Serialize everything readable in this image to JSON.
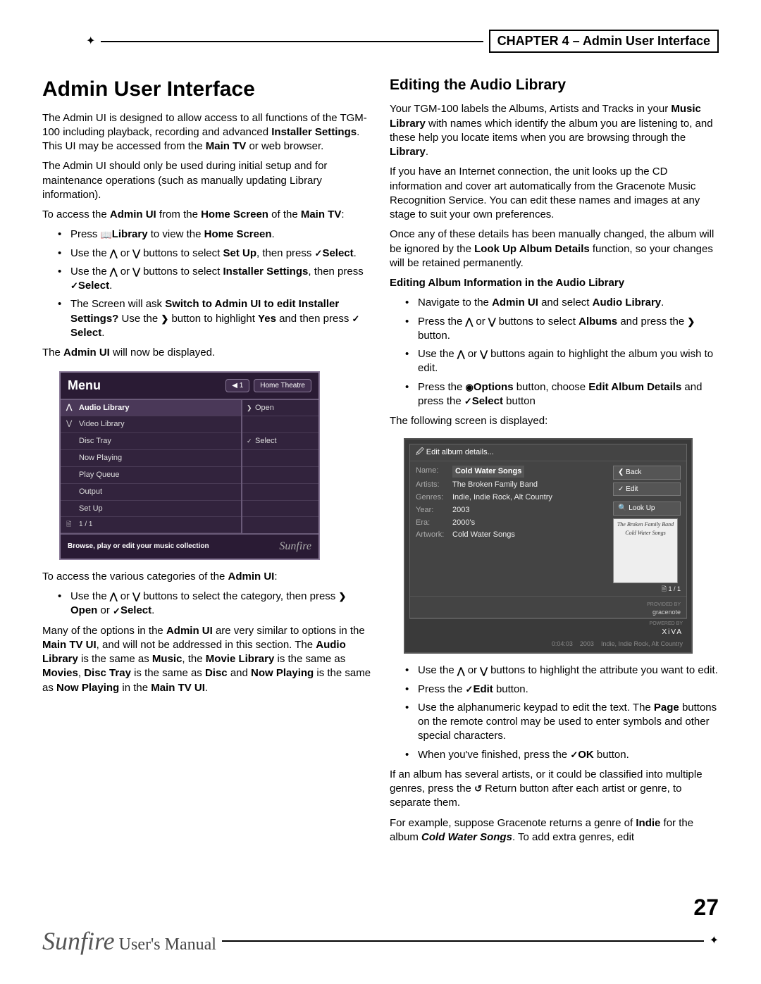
{
  "header": {
    "chapter": "CHAPTER 4 – Admin User Interface"
  },
  "left": {
    "h1": "Admin User Interface",
    "p1a": "The Admin UI is designed to allow access to all functions of the TGM-100 including playback, recording and advanced ",
    "p1b": "Installer Settings",
    "p1c": ". This UI may be accessed from the ",
    "p1d": "Main TV",
    "p1e": " or web browser.",
    "p2": "The Admin UI should only be used during initial setup and for maintenance operations (such as manually updating Library information).",
    "p3a": "To access the ",
    "p3b": "Admin UI",
    "p3c": " from the ",
    "p3d": "Home Screen",
    "p3e": " of the ",
    "p3f": "Main TV",
    "p3g": ":",
    "li1a": "Press ",
    "li1b": "Library",
    "li1c": " to view the ",
    "li1d": "Home Screen",
    "li1e": ".",
    "li2a": "Use the ",
    "li2b": " or ",
    "li2c": " buttons to select ",
    "li2d": "Set Up",
    "li2e": ", then press ",
    "li2f": "Select",
    "li2g": ".",
    "li3a": "Use the ",
    "li3b": " or ",
    "li3c": " buttons to select ",
    "li3d": "Installer Settings",
    "li3e": ", then press ",
    "li3f": "Select",
    "li3g": ".",
    "li4a": "The Screen will ask ",
    "li4b": "Switch to Admin UI to edit Installer Settings?",
    "li4c": " Use the ",
    "li4d": " button to highlight ",
    "li4e": "Yes",
    "li4f": " and then press ",
    "li4g": "Select",
    "li4h": ".",
    "p4a": "The ",
    "p4b": "Admin UI",
    "p4c": " will now be displayed.",
    "p5a": "To access the various categories of the ",
    "p5b": "Admin UI",
    "p5c": ":",
    "li5a": "Use the ",
    "li5b": " or ",
    "li5c": " buttons to select the category, then press ",
    "li5d": "Open",
    "li5e": " or ",
    "li5f": "Select",
    "li5g": ".",
    "p6a": "Many of the options in the ",
    "p6b": "Admin UI",
    "p6c": " are very similar to options in the ",
    "p6d": "Main TV UI",
    "p6e": ", and will not be addressed in this section. The ",
    "p6f": "Audio Library",
    "p6g": " is the same as ",
    "p6h": "Music",
    "p6i": ", the ",
    "p6j": "Movie Library",
    "p6k": " is the same as ",
    "p6l": "Movies",
    "p6m": ", ",
    "p6n": "Disc Tray",
    "p6o": " is the same as ",
    "p6p": "Disc",
    "p6q": " and ",
    "p6r": "Now Playing",
    "p6s": " is the same as ",
    "p6t": "Now Playing",
    "p6u": " in the ",
    "p6v": "Main TV UI",
    "p6w": "."
  },
  "menu": {
    "title": "Menu",
    "speaker": "◀ 1",
    "location": "Home Theatre",
    "items": [
      "Audio Library",
      "Video Library",
      "Disc Tray",
      "Now Playing",
      "Play Queue",
      "Output",
      "Set Up"
    ],
    "open": "Open",
    "select": "Select",
    "page": "1 / 1",
    "footer": "Browse, play or edit your music collection",
    "brand": "Sunfire"
  },
  "right": {
    "h2": "Editing the Audio Library",
    "p1a": "Your TGM-100 labels the Albums, Artists and Tracks in your ",
    "p1b": "Music Library",
    "p1c": " with names which identify the album you are listening to, and these help you locate items when you are browsing through the ",
    "p1d": "Library",
    "p1e": ".",
    "p2": "If you have an Internet connection, the unit looks up the CD information and cover art automatically from the Gracenote Music Recognition Service. You can edit these names and images at any stage to suit your own preferences.",
    "p3a": "Once any of these details has been manually changed, the album will be ignored by the ",
    "p3b": "Look Up Album Details",
    "p3c": " function, so your changes will be retained permanently.",
    "sub1": "Editing Album Information in the Audio Library",
    "li1a": "Navigate to the ",
    "li1b": "Admin UI",
    "li1c": " and select ",
    "li1d": "Audio Library",
    "li1e": ".",
    "li2a": "Press the ",
    "li2b": " or ",
    "li2c": " buttons to select ",
    "li2d": "Albums",
    "li2e": " and press the ",
    "li2f": " button.",
    "li3a": "Use the ",
    "li3b": " or ",
    "li3c": " buttons again to highlight the album you wish to edit.",
    "li4a": "Press the ",
    "li4b": "Options",
    "li4c": " button, choose ",
    "li4d": "Edit Album Details",
    "li4e": " and press the ",
    "li4f": "Select",
    "li4g": " button",
    "p4": "The following screen is displayed:",
    "li5a": "Use the ",
    "li5b": " or ",
    "li5c": " buttons to highlight the attribute you want to edit.",
    "li6a": "Press the ",
    "li6b": "Edit",
    "li6c": " button.",
    "li7a": "Use the alphanumeric keypad to edit the text. The ",
    "li7b": "Page",
    "li7c": " buttons on the remote control may be used to enter symbols and other special characters.",
    "li8a": "When you've finished, press the ",
    "li8b": "OK",
    "li8c": " button.",
    "p5a": "If an album has several artists, or it could be classified into multiple genres, press the ",
    "p5b": " Return button after each artist or genre, to separate them.",
    "p6a": "For example, suppose Gracenote returns a genre of ",
    "p6b": "Indie",
    "p6c": " for the album ",
    "p6d": "Cold Water Songs",
    "p6e": ". To add extra genres, edit"
  },
  "edit": {
    "title": "Edit album details...",
    "rows": {
      "name_l": "Name:",
      "name_v": "Cold Water Songs",
      "artists_l": "Artists:",
      "artists_v": "The Broken Family Band",
      "genres_l": "Genres:",
      "genres_v": "Indie, Indie Rock, Alt Country",
      "year_l": "Year:",
      "year_v": "2003",
      "era_l": "Era:",
      "era_v": "2000's",
      "art_l": "Artwork:",
      "art_v": "Cold Water Songs"
    },
    "btn_back": "Back",
    "btn_edit": "Edit",
    "btn_lookup": "Look Up",
    "page": "1 / 1",
    "providedby": "PROVIDED BY",
    "gracenote": "gracenote",
    "powered": "POWERED BY",
    "xiva": "XiVA",
    "status_time": "0:04:03",
    "status_year": "2003",
    "status_tags": "Indie, Indie Rock, Alt Country",
    "cover_artist": "The Broken Family Band",
    "cover_title": "Cold Water Songs"
  },
  "footer": {
    "brand": "Sunfire",
    "label": " User's Manual",
    "page": "27"
  },
  "glyphs": {
    "library": "📖",
    "up": "⋀",
    "down": "⋁",
    "check": "✓",
    "right": "❯",
    "left": "❮",
    "target": "◉",
    "return": "↺",
    "page_i": "🗎",
    "magnify": "🔍"
  }
}
